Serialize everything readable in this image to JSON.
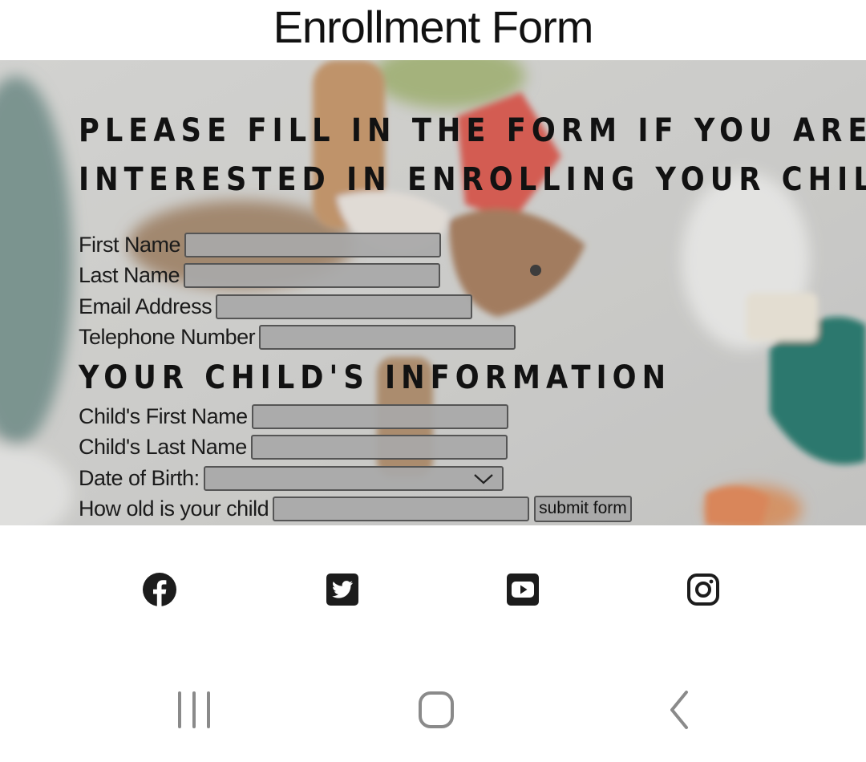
{
  "header": {
    "title": "Enrollment Form"
  },
  "form": {
    "heading": "PLEASE FILL IN THE FORM IF YOU ARE INTERESTED IN ENROLLING YOUR CHILD",
    "heading_line1": "PLEASE FILL IN THE FORM IF YOU ARE",
    "heading_line2": "INTERESTED IN ENROLLING YOUR CHILD",
    "parent_fields": {
      "first_name": {
        "label": "First Name",
        "value": ""
      },
      "last_name": {
        "label": "Last Name",
        "value": ""
      },
      "email": {
        "label": "Email Address",
        "value": ""
      },
      "telephone": {
        "label": "Telephone Number",
        "value": ""
      }
    },
    "child_heading": "YOUR CHILD'S INFORMATION",
    "child_fields": {
      "first_name": {
        "label": "Child's First Name",
        "value": ""
      },
      "last_name": {
        "label": "Child's Last Name",
        "value": ""
      },
      "dob": {
        "label": "Date of Birth:",
        "selected": ""
      },
      "age": {
        "label": "How old is your child",
        "value": ""
      }
    },
    "submit_label": "submit form"
  },
  "social": {
    "icons": [
      "facebook-icon",
      "twitter-icon",
      "youtube-icon",
      "instagram-icon"
    ],
    "icon_color": "#1c1c1c"
  },
  "system_nav": {
    "icons": [
      "recent-apps-icon",
      "home-icon",
      "back-icon"
    ],
    "icon_color": "#8a8a8a"
  },
  "colors": {
    "field_background": "#a8a8a8",
    "heading": "#121212"
  }
}
